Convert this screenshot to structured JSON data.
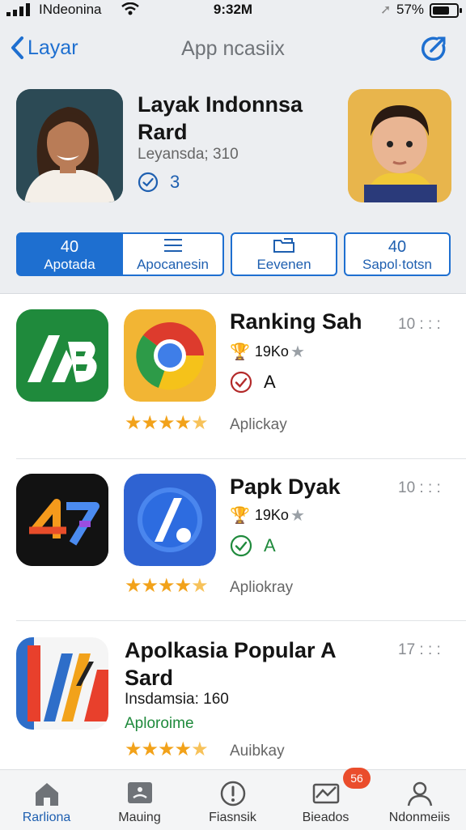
{
  "status_bar": {
    "carrier": "INdeonina",
    "time": "9:32M",
    "battery": "57%"
  },
  "nav": {
    "back_label": "Layar",
    "title": "App ncasiix"
  },
  "profile": {
    "name_line1": "Layak Indonnsa",
    "name_line2": "Rard",
    "subtitle": "Leyansda; 310",
    "count": "3"
  },
  "tabs": [
    {
      "icon_text": "40",
      "label": "Apotada"
    },
    {
      "icon_text": "",
      "label": "Apocanesin"
    },
    {
      "icon_text": "",
      "label": "Eevenen"
    },
    {
      "icon_text": "40",
      "label": "Sapol·totsn"
    }
  ],
  "apps": [
    {
      "title_line1": "Ranking Sah",
      "title_line2": "",
      "rating": "19Ko",
      "check_label": "A",
      "category": "Aplickay",
      "time": "10 : : :"
    },
    {
      "title_line1": "Papk Dyak",
      "title_line2": "",
      "rating": "19Ko",
      "check_label": "A",
      "category": "Apliokray",
      "time": "10 : : :"
    },
    {
      "title_line1": "Apolkasia Popular A",
      "title_line2": "Sard",
      "info": "Insdamsia: 160",
      "developer": "Aploroime",
      "category": "Auibkay",
      "time": "17 : : :"
    }
  ],
  "bottom_nav": [
    {
      "label": "Rarliona"
    },
    {
      "label": "Mauing"
    },
    {
      "label": "Fiasnsik"
    },
    {
      "label": "Bieados"
    },
    {
      "label": "Ndonmeiis"
    }
  ],
  "badge": "56",
  "colors": {
    "accent": "#1e6fd0",
    "star": "#f2a21a",
    "badge": "#ea4d2c",
    "success_green": "#1f8a3c"
  },
  "icons": [
    "signal-icon",
    "wifi-icon",
    "location-arrow-icon",
    "battery-icon",
    "chevron-left-icon",
    "edit-circle-icon",
    "check-circle-icon",
    "star-icon",
    "home-icon",
    "media-icon",
    "alert-icon",
    "mail-icon",
    "user-icon"
  ]
}
